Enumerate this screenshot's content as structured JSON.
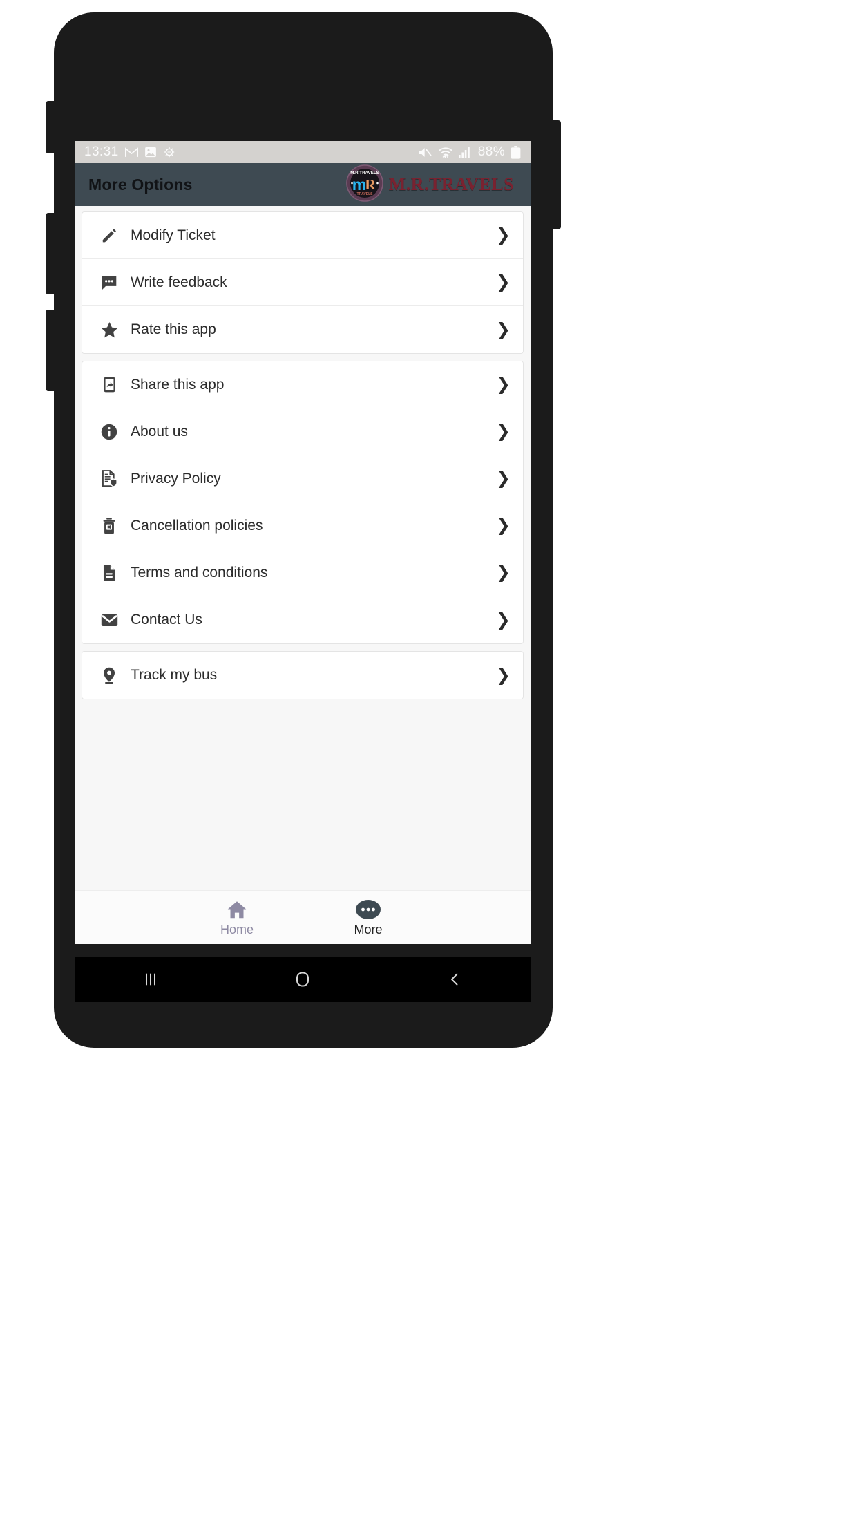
{
  "status_bar": {
    "time": "13:31",
    "left_icons": [
      "gmail-icon",
      "photos-icon",
      "android-settings-icon"
    ],
    "right_icons": [
      "mute-icon",
      "wifi-icon",
      "cellular-signal-icon"
    ],
    "battery_percent": "88%",
    "battery_icon": "battery-icon",
    "background_color": "#d4d2cf"
  },
  "app_bar": {
    "title": "More Options",
    "brand_name": "M.R.TRAVELS",
    "brand_logo": "mr-travels-logo",
    "background_color": "#3e4a52",
    "brand_color": "#7a2230"
  },
  "menu_groups": [
    {
      "group_name": "ticket-actions",
      "items": [
        {
          "label": "Modify Ticket",
          "icon": "pencil-icon",
          "chevron": "❯"
        },
        {
          "label": "Write feedback",
          "icon": "chat-bubble-icon",
          "chevron": "❯"
        },
        {
          "label": "Rate this app",
          "icon": "star-icon",
          "chevron": "❯"
        }
      ]
    },
    {
      "group_name": "info-and-legal",
      "items": [
        {
          "label": "Share this app",
          "icon": "share-phone-icon",
          "chevron": "❯"
        },
        {
          "label": "About us",
          "icon": "info-circle-icon",
          "chevron": "❯"
        },
        {
          "label": "Privacy Policy",
          "icon": "document-shield-icon",
          "chevron": "❯"
        },
        {
          "label": "Cancellation policies",
          "icon": "trash-x-icon",
          "chevron": "❯"
        },
        {
          "label": "Terms and conditions",
          "icon": "document-icon",
          "chevron": "❯"
        },
        {
          "label": "Contact Us",
          "icon": "envelope-icon",
          "chevron": "❯"
        }
      ]
    },
    {
      "group_name": "tracking",
      "items": [
        {
          "label": "Track my bus",
          "icon": "location-pin-icon",
          "chevron": "❯"
        }
      ]
    }
  ],
  "bottom_nav": {
    "items": [
      {
        "label": "Home",
        "icon": "home-icon",
        "active": false,
        "color": "#8e8aa3"
      },
      {
        "label": "More",
        "icon": "more-dots-icon",
        "active": true,
        "color": "#3e4a52"
      }
    ]
  },
  "android_nav": {
    "recents_icon": "recent-apps-icon",
    "home_icon": "android-home-icon",
    "back_icon": "android-back-icon"
  }
}
